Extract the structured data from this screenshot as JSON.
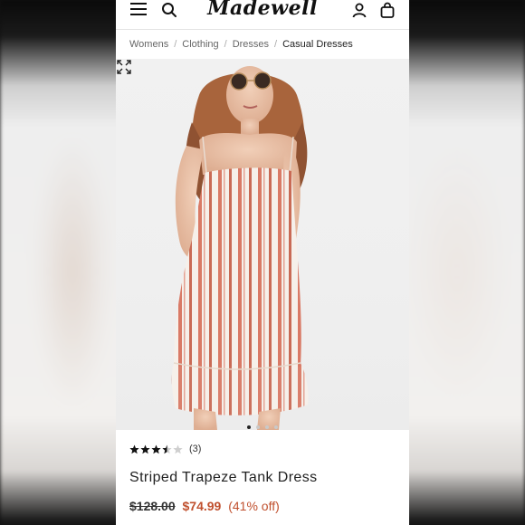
{
  "header": {
    "logo_text": "Madewell"
  },
  "breadcrumb": [
    {
      "label": "Womens"
    },
    {
      "label": "Clothing"
    },
    {
      "label": "Dresses"
    },
    {
      "label": "Casual Dresses"
    }
  ],
  "gallery": {
    "image_count": 4,
    "active_index": 0
  },
  "product": {
    "rating": 3.5,
    "rating_max": 5,
    "review_count": "(3)",
    "name": "Striped Trapeze Tank Dress",
    "original_price": "$128.00",
    "sale_price": "$74.99",
    "discount": "(41% off)"
  },
  "colors": {
    "accent": "#c0502e",
    "stripe": "#d97a66"
  },
  "icons": {
    "menu": "hamburger-icon",
    "search": "search-icon",
    "account": "user-icon",
    "bag": "shopping-bag-icon",
    "expand": "expand-icon"
  }
}
